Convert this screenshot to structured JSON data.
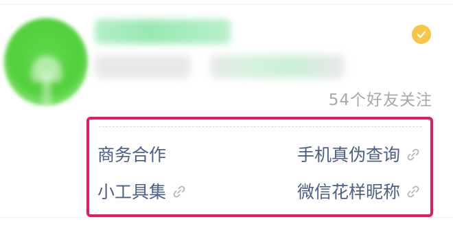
{
  "profile": {
    "friend_count_text": "54个好友关注",
    "verified_badge_color": "#f7c548",
    "verified_icon": "check-icon"
  },
  "menu": {
    "highlight_color": "#e5195e",
    "link_color": "#4b5f86",
    "items": [
      {
        "label": "商务合作",
        "has_link_icon": false
      },
      {
        "label": "手机真伪查询",
        "has_link_icon": true
      },
      {
        "label": "小工具集",
        "has_link_icon": true
      },
      {
        "label": "微信花样昵称",
        "has_link_icon": true
      }
    ],
    "link_icon": "link-icon"
  }
}
